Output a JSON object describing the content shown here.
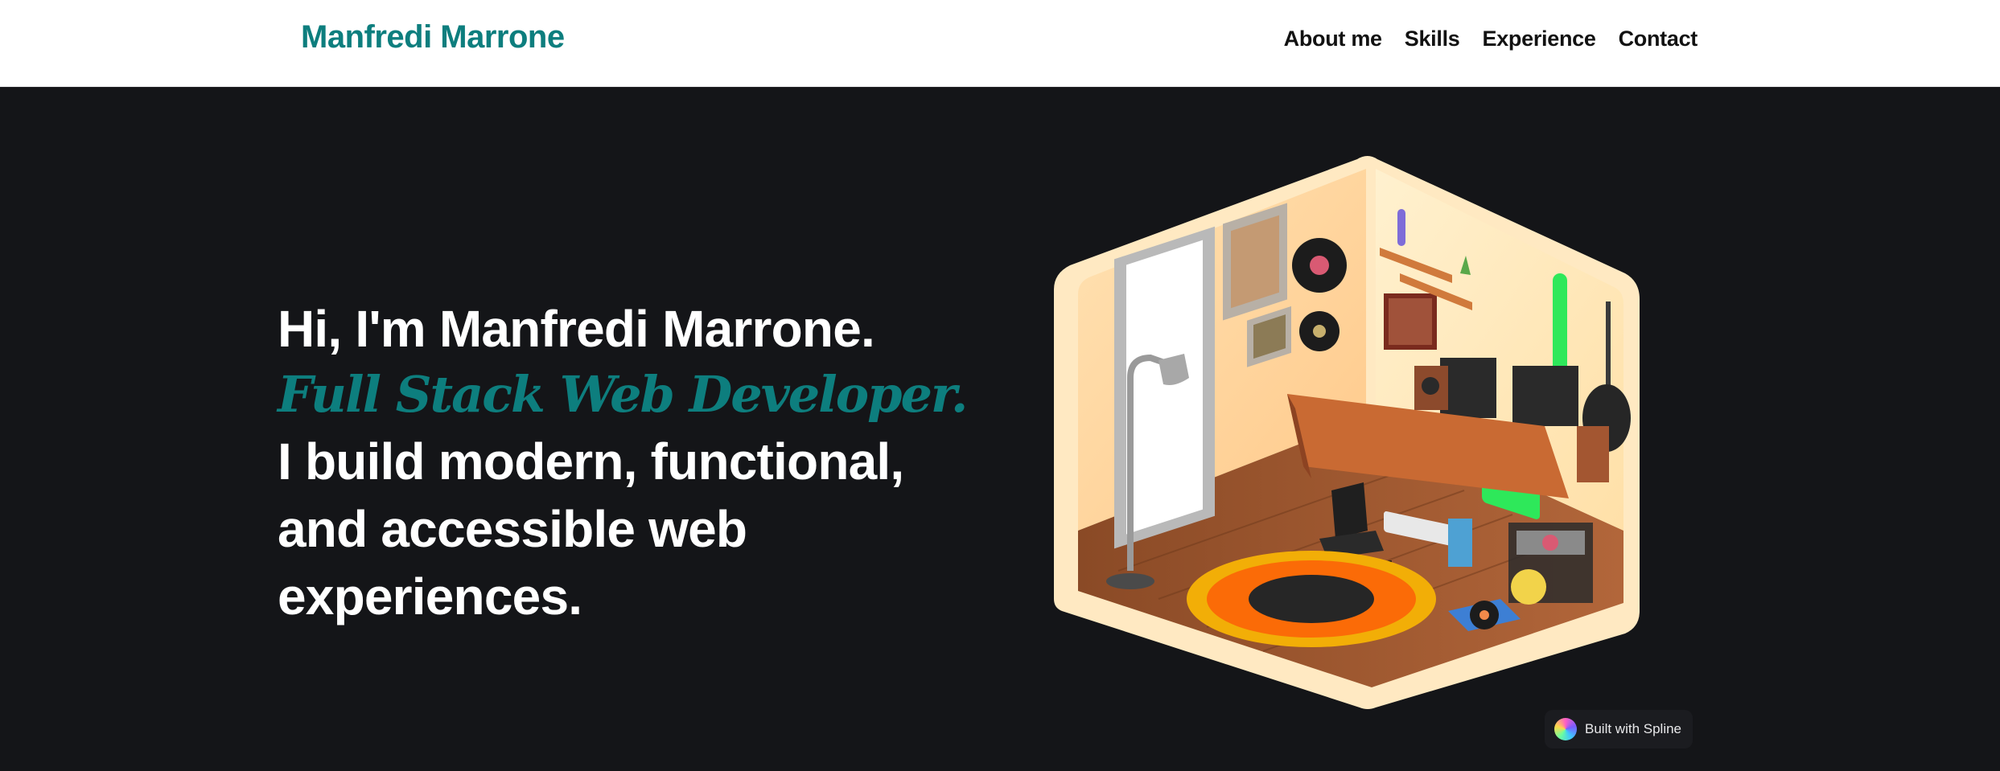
{
  "header": {
    "brand": "Manfredi Marrone",
    "nav": [
      "About me",
      "Skills",
      "Experience",
      "Contact"
    ]
  },
  "hero": {
    "greeting": "Hi, I'm Manfredi Marrone.",
    "role": "Full Stack Web Developer.",
    "tagline": "I build modern, functional, and accessible web experiences."
  },
  "scene": {
    "icon": "isometric-room-illustration"
  },
  "badge": {
    "label": "Built with Spline",
    "icon": "spline-logo-icon"
  },
  "colors": {
    "accent": "#0d7e7e",
    "background": "#141518",
    "header_bg": "#ffffff"
  }
}
